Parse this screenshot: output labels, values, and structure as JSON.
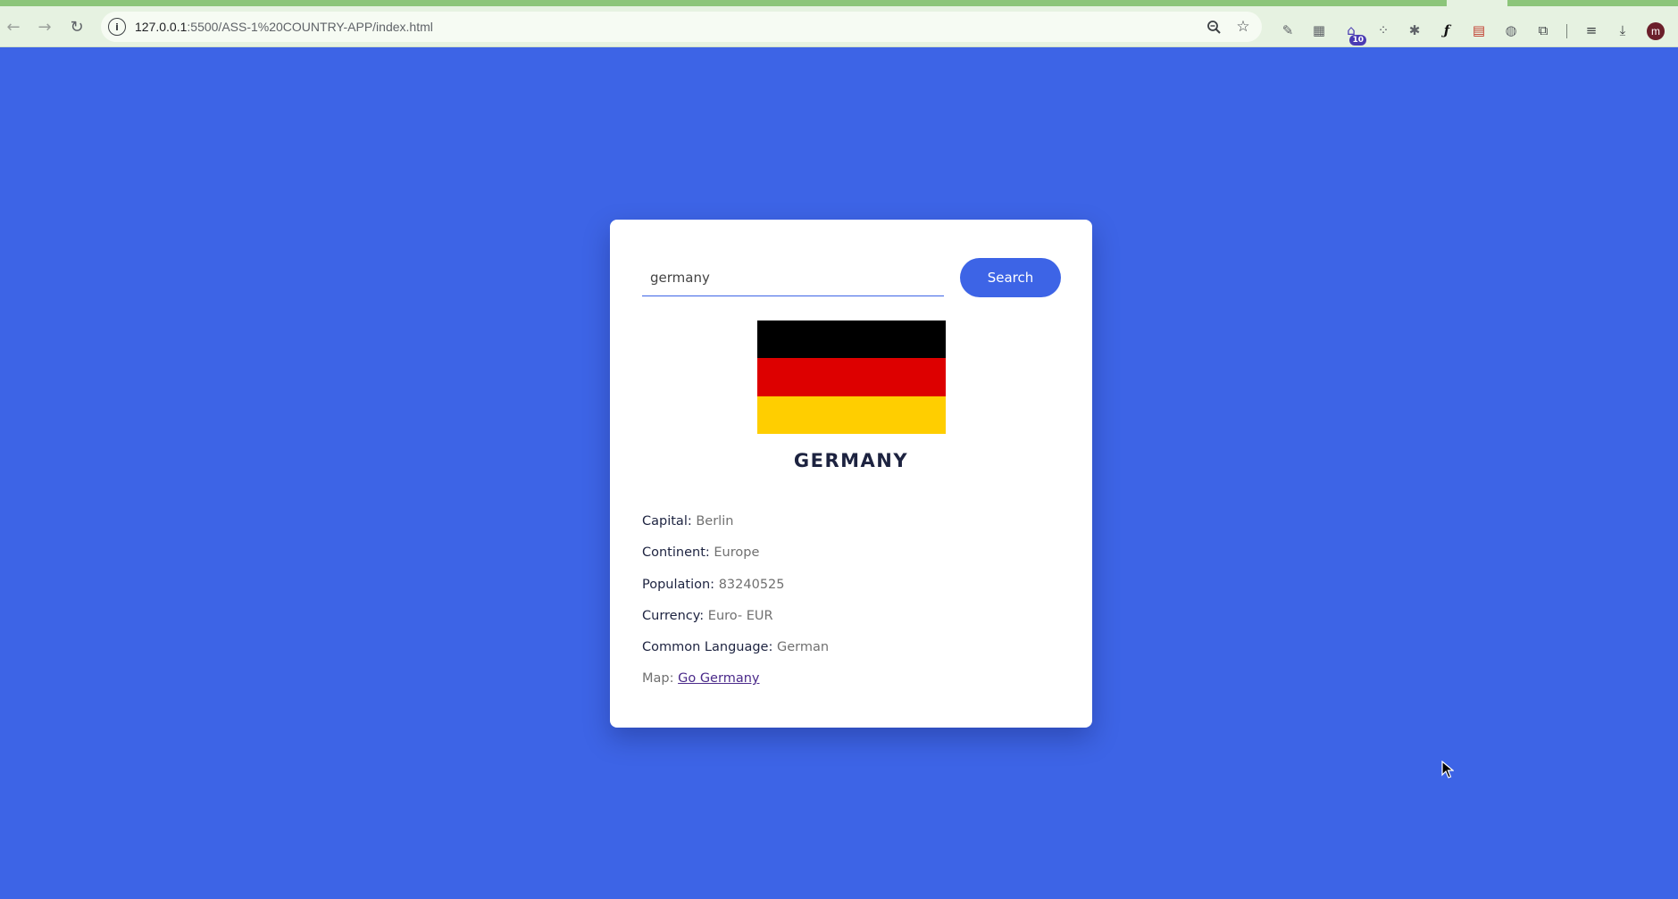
{
  "browser": {
    "url_host": "127.0.0.1",
    "url_path": ":5500/ASS-1%20COUNTRY-APP/index.html",
    "extension_badge": "10",
    "profile_initial": "m",
    "icons": {
      "back": "arrow-left-icon",
      "forward": "arrow-right-icon",
      "reload": "reload-icon",
      "site_info": "info-icon",
      "zoom": "zoom-icon",
      "bookmark": "star-icon"
    }
  },
  "search": {
    "value": "germany",
    "button_label": "Search"
  },
  "country": {
    "name": "GERMANY",
    "flag_colors": [
      "#000000",
      "#dd0000",
      "#ffce00"
    ]
  },
  "details": {
    "capital_label": "Capital:",
    "capital": "Berlin",
    "continent_label": "Continent:",
    "continent": "Europe",
    "population_label": "Population:",
    "population": "83240525",
    "currency_label": "Currency:",
    "currency": "Euro- EUR",
    "language_label": "Common Language:",
    "language": "German",
    "map_label": "Map:",
    "map_link": "Go Germany"
  },
  "colors": {
    "background": "#3d64e6",
    "accent": "#3d64e6",
    "card": "#ffffff"
  }
}
